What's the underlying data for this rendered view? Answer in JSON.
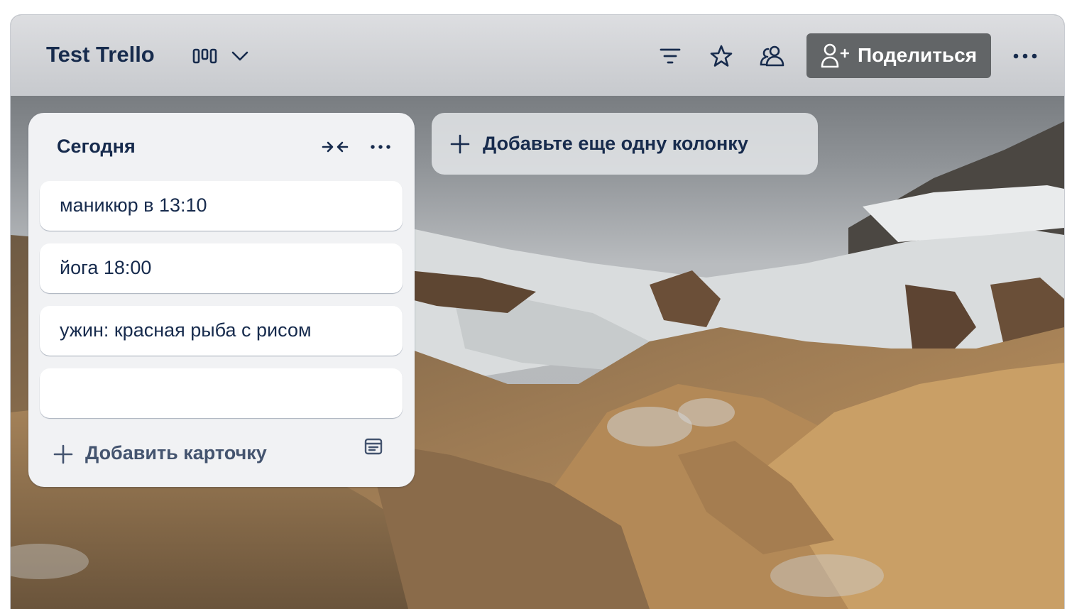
{
  "board": {
    "title": "Test Trello"
  },
  "header": {
    "view_switcher_icon": "board-icon",
    "view_switcher_chevron_icon": "chevron-down-icon",
    "filter_icon": "filter-icon",
    "star_icon": "star-icon",
    "members_icon": "members-icon",
    "share_icon": "add-person-icon",
    "share_label": "Поделиться",
    "more_icon": "more-icon"
  },
  "lists": [
    {
      "title": "Сегодня",
      "collapse_icon": "collapse-icon",
      "menu_icon": "more-icon",
      "cards": [
        {
          "text": "маникюр в 13:10"
        },
        {
          "text": "йога 18:00"
        },
        {
          "text": "ужин: красная рыба с рисом"
        },
        {
          "text": ""
        }
      ],
      "add_card_label": "Добавить карточку",
      "add_card_icon": "plus-icon",
      "template_icon": "card-template-icon"
    }
  ],
  "add_list": {
    "label": "Добавьте еще одну колонку",
    "icon": "plus-icon"
  },
  "colors": {
    "text_primary": "#172b4d",
    "text_secondary": "#44546f",
    "share_button_bg": "#626567",
    "list_bg": "#f1f2f4",
    "card_bg": "#ffffff"
  }
}
